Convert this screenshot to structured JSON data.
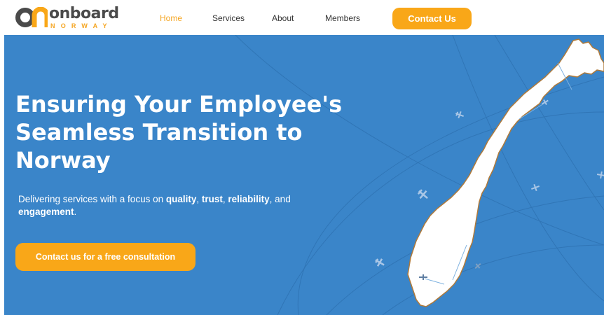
{
  "brand": {
    "name": "onboard",
    "tagline": "NORWAY",
    "colors": {
      "primary_orange": "#f9a718",
      "hero_blue": "#3a85c9",
      "logo_gray": "#4a4a4a"
    }
  },
  "nav": {
    "items": [
      {
        "label": "Home",
        "active": true
      },
      {
        "label": "Services",
        "active": false
      },
      {
        "label": "About",
        "active": false
      },
      {
        "label": "Members",
        "active": false
      }
    ],
    "contact_label": "Contact Us"
  },
  "hero": {
    "title": "Ensuring Your Employee's Seamless Transition to Norway",
    "subtitle_parts": {
      "lead": "Delivering services with a focus on ",
      "quality": "quality",
      "sep1": ", ",
      "trust": "trust",
      "sep2": ", ",
      "reliability": "reliability",
      "sep3": ", and ",
      "engagement": "engagement",
      "end": "."
    },
    "cta_label": "Contact us for a free consultation",
    "illustration": "norway-map-with-airplanes"
  }
}
